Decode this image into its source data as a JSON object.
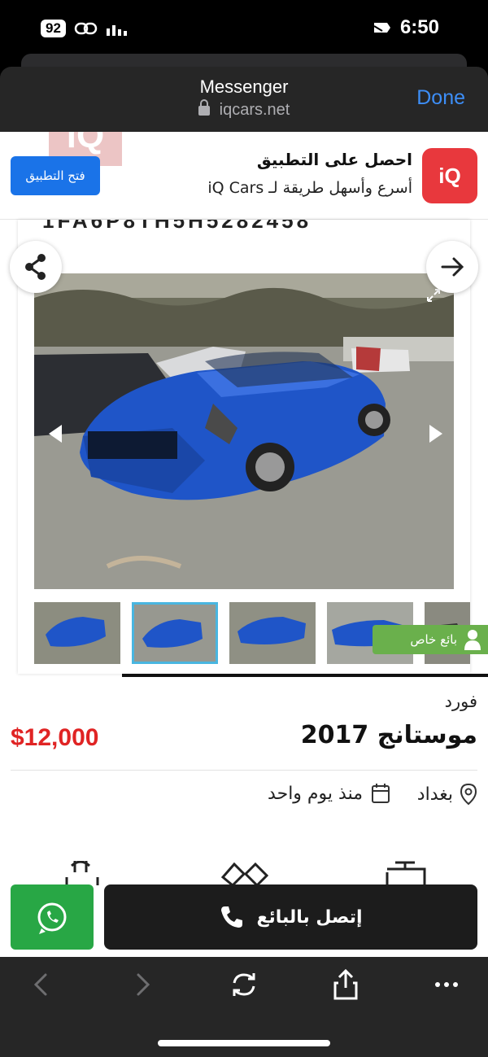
{
  "status_bar": {
    "battery": "92",
    "time": "6:50"
  },
  "messenger_header": {
    "title": "Messenger",
    "url": "iqcars.net",
    "done_label": "Done"
  },
  "app_banner": {
    "watermark_logo": "iQ",
    "open_app_label": "فتح التطبيق",
    "app_logo": "iQ",
    "title": "احصل على التطبيق",
    "subtitle": "أسرع وأسهل طريقة لـ iQ Cars"
  },
  "gallery": {
    "partial_heading": "1FA6P8TH5H5282458",
    "thumbnail_count": 5,
    "active_thumbnail": 2,
    "seller_badge": "بائع خاص"
  },
  "listing": {
    "brand": "فورد",
    "model": "موستانج 2017",
    "price": "$12,000",
    "location": "بغداد",
    "posted": "منذ يوم واحد"
  },
  "actions": {
    "call_label": "إتصل بالبائع",
    "whatsapp_icon": "whatsapp-icon"
  },
  "colors": {
    "price": "#e02424",
    "call_button": "#1c1c1c",
    "whatsapp_button": "#28a745",
    "seller_badge": "#6ab04c",
    "open_app_button": "#1a73e8",
    "done": "#3d8ef7"
  }
}
